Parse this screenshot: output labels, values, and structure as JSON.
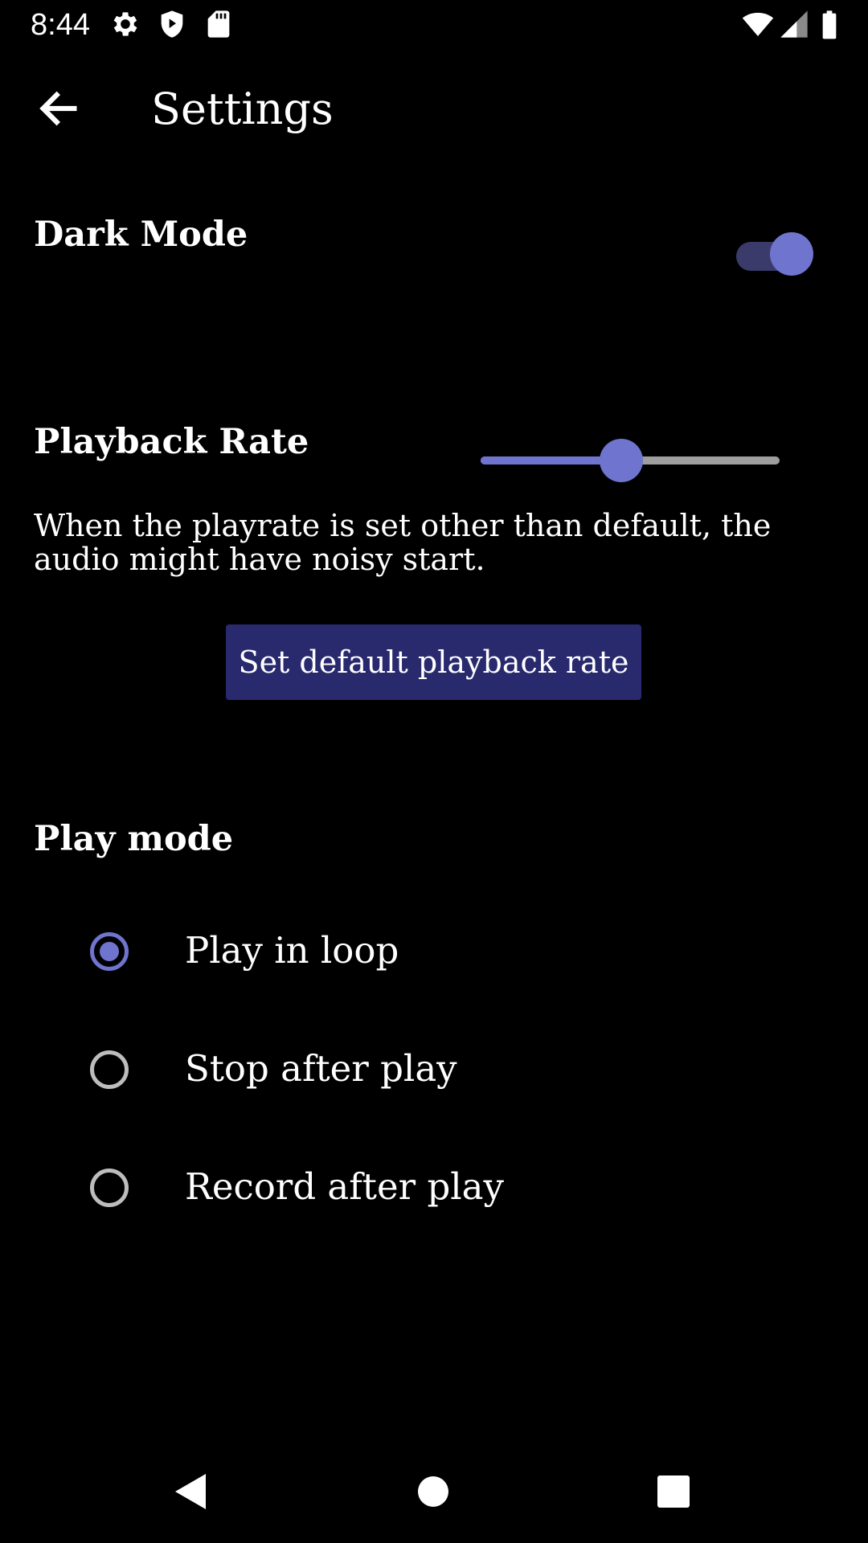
{
  "status_bar": {
    "time": "8:44",
    "left_icons": [
      "gear-icon",
      "shield-play-icon",
      "sd-card-icon"
    ],
    "right_icons": [
      "wifi-icon",
      "cell-signal-icon",
      "battery-icon"
    ]
  },
  "app_bar": {
    "back_icon": "arrow-back-icon",
    "title": "Settings"
  },
  "dark_mode": {
    "label": "Dark Mode",
    "enabled": true
  },
  "playback_rate": {
    "label": "Playback Rate",
    "slider_fraction": 0.47,
    "note": "When the playrate is set other than default, the audio might have noisy start.",
    "default_button_label": "Set default playback rate"
  },
  "play_mode": {
    "label": "Play mode",
    "options": [
      {
        "label": "Play in loop",
        "selected": true
      },
      {
        "label": "Stop after play",
        "selected": false
      },
      {
        "label": "Record after play",
        "selected": false
      }
    ]
  },
  "nav_bar": {
    "icons": [
      "nav-back-icon",
      "nav-home-icon",
      "nav-recents-icon"
    ]
  },
  "colors": {
    "background": "#000000",
    "accent": "#6f74cf",
    "switch_track": "#3b3b6b",
    "button": "#292a6e",
    "slider_inactive": "#9e9e9e"
  }
}
